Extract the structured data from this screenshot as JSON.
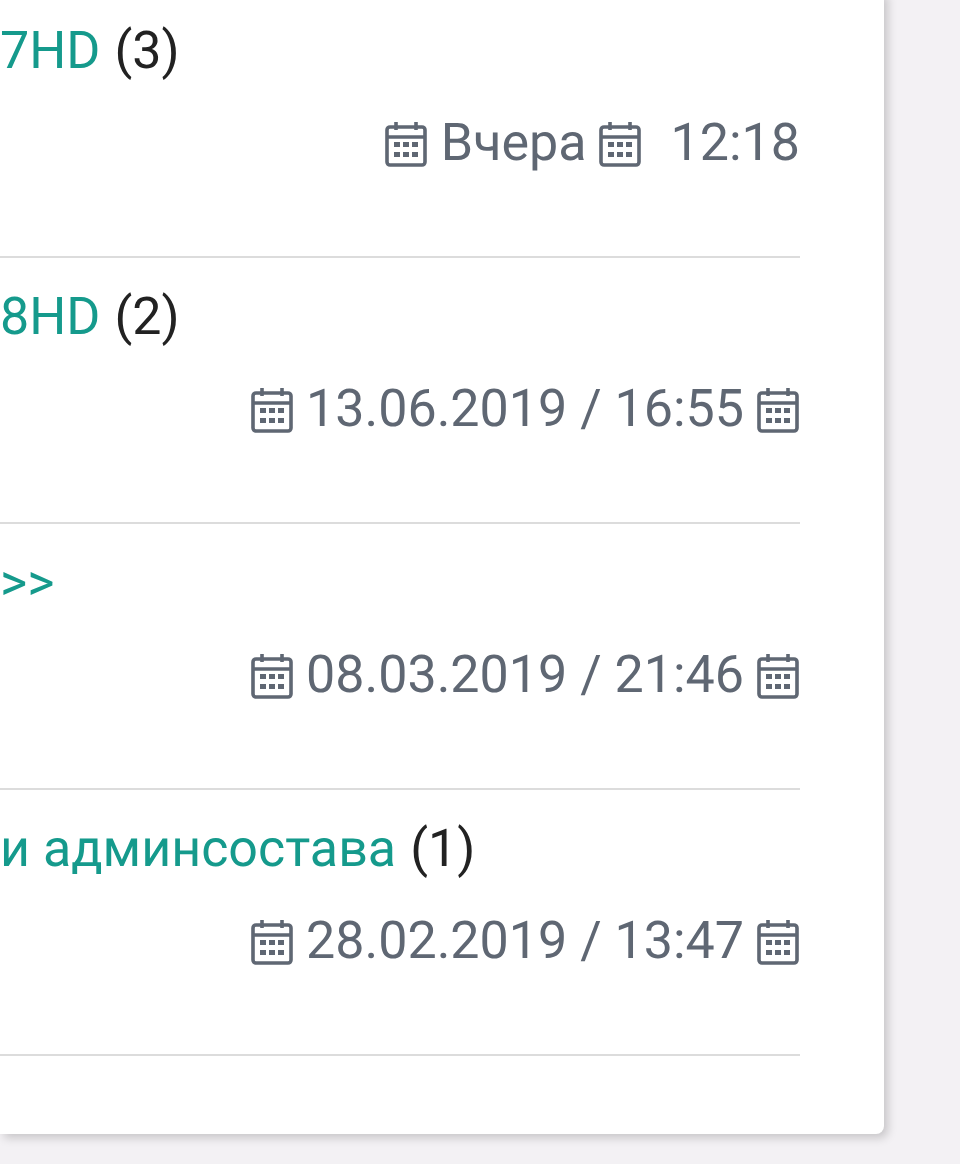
{
  "topics": [
    {
      "title": "7HD",
      "count": "(3)",
      "kind": "day_time",
      "date": "Вчера",
      "time": "12:18"
    },
    {
      "title": "8HD",
      "count": "(2)",
      "kind": "datetime",
      "stamp": "13.06.2019 / 16:55"
    },
    {
      "title": ">>",
      "kind": "datetime",
      "stamp": "08.03.2019 / 21:46"
    },
    {
      "title": "и админсостава",
      "count": "(1)",
      "kind": "datetime",
      "stamp": "28.02.2019 / 13:47"
    }
  ]
}
